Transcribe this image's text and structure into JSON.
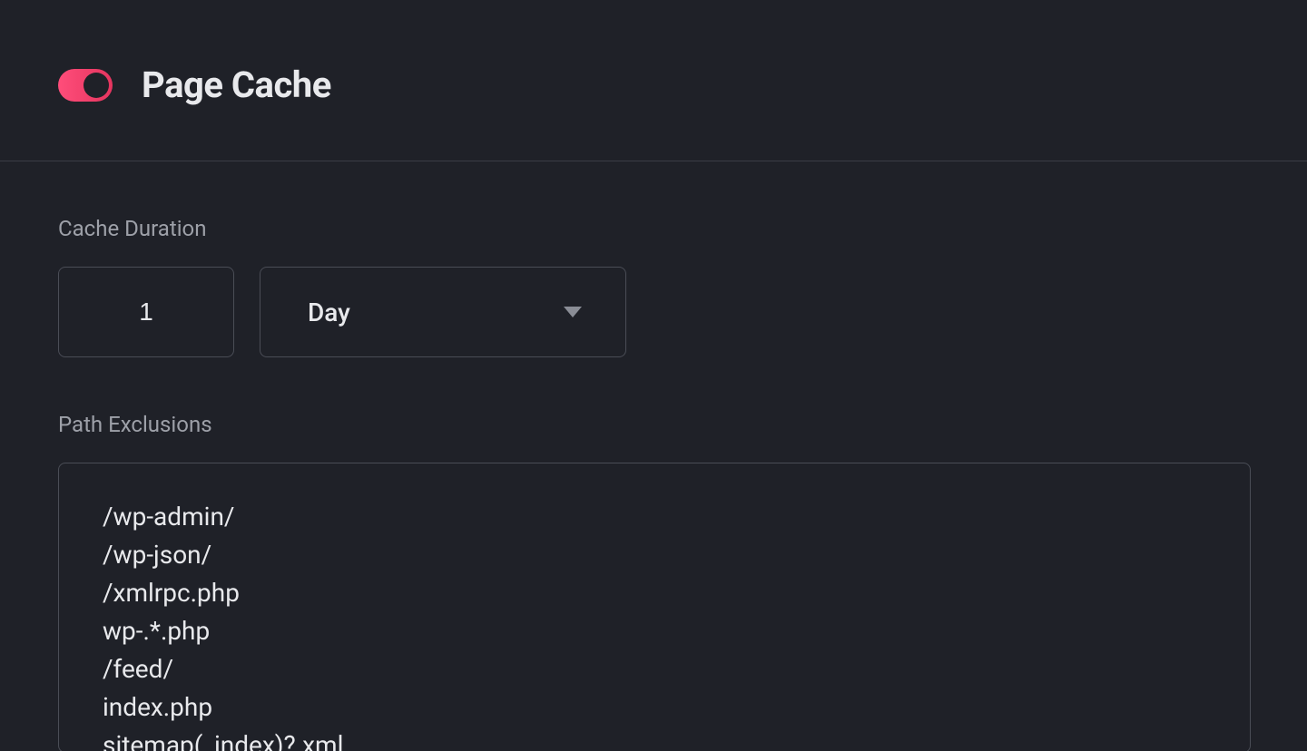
{
  "header": {
    "toggle_on": true,
    "title": "Page Cache"
  },
  "cache_duration": {
    "label": "Cache Duration",
    "value": "1",
    "unit_selected": "Day"
  },
  "path_exclusions": {
    "label": "Path Exclusions",
    "value": "/wp-admin/\n/wp-json/\n/xmlrpc.php\nwp-.*.php\n/feed/\nindex.php\nsitemap(_index)?.xml"
  }
}
